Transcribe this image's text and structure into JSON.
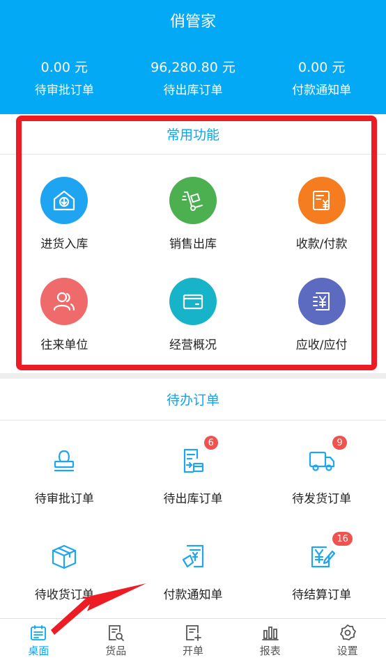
{
  "header": {
    "title": "俏管家"
  },
  "stats": [
    {
      "value": "0.00 元",
      "label": "待审批订单"
    },
    {
      "value": "96,280.80 元",
      "label": "待出库订单"
    },
    {
      "value": "0.00 元",
      "label": "付款通知单"
    }
  ],
  "common": {
    "title": "常用功能",
    "items": [
      {
        "label": "进货入库",
        "icon": "inbox-download-icon",
        "color": "#1ea4f0"
      },
      {
        "label": "销售出库",
        "icon": "hand-truck-icon",
        "color": "#4caf50"
      },
      {
        "label": "收款/付款",
        "icon": "invoice-yen-icon",
        "color": "#f57c1f"
      },
      {
        "label": "往来单位",
        "icon": "users-icon",
        "color": "#ef6a6a"
      },
      {
        "label": "经营概况",
        "icon": "wallet-card-icon",
        "color": "#17b3c9"
      },
      {
        "label": "应收/应付",
        "icon": "yen-bill-icon",
        "color": "#5c6bc0"
      }
    ]
  },
  "todo": {
    "title": "待办订单",
    "items": [
      {
        "label": "待审批订单",
        "icon": "stamp-icon",
        "badge": ""
      },
      {
        "label": "待出库订单",
        "icon": "document-export-icon",
        "badge": "6"
      },
      {
        "label": "待发货订单",
        "icon": "delivery-truck-icon",
        "badge": "9"
      },
      {
        "label": "待收货订单",
        "icon": "package-box-icon",
        "badge": ""
      },
      {
        "label": "付款通知单",
        "icon": "payment-notice-icon",
        "badge": ""
      },
      {
        "label": "待结算订单",
        "icon": "yen-edit-icon",
        "badge": "16"
      }
    ]
  },
  "tabbar": [
    {
      "label": "桌面",
      "icon": "calendar-icon",
      "active": true
    },
    {
      "label": "货品",
      "icon": "doc-search-icon",
      "active": false
    },
    {
      "label": "开单",
      "icon": "doc-add-icon",
      "active": false
    },
    {
      "label": "报表",
      "icon": "bar-chart-icon",
      "active": false
    },
    {
      "label": "设置",
      "icon": "gear-icon",
      "active": false
    }
  ],
  "colors": {
    "primary": "#03a9f4",
    "highlight": "#ed1c24",
    "badge": "#ef5350"
  }
}
